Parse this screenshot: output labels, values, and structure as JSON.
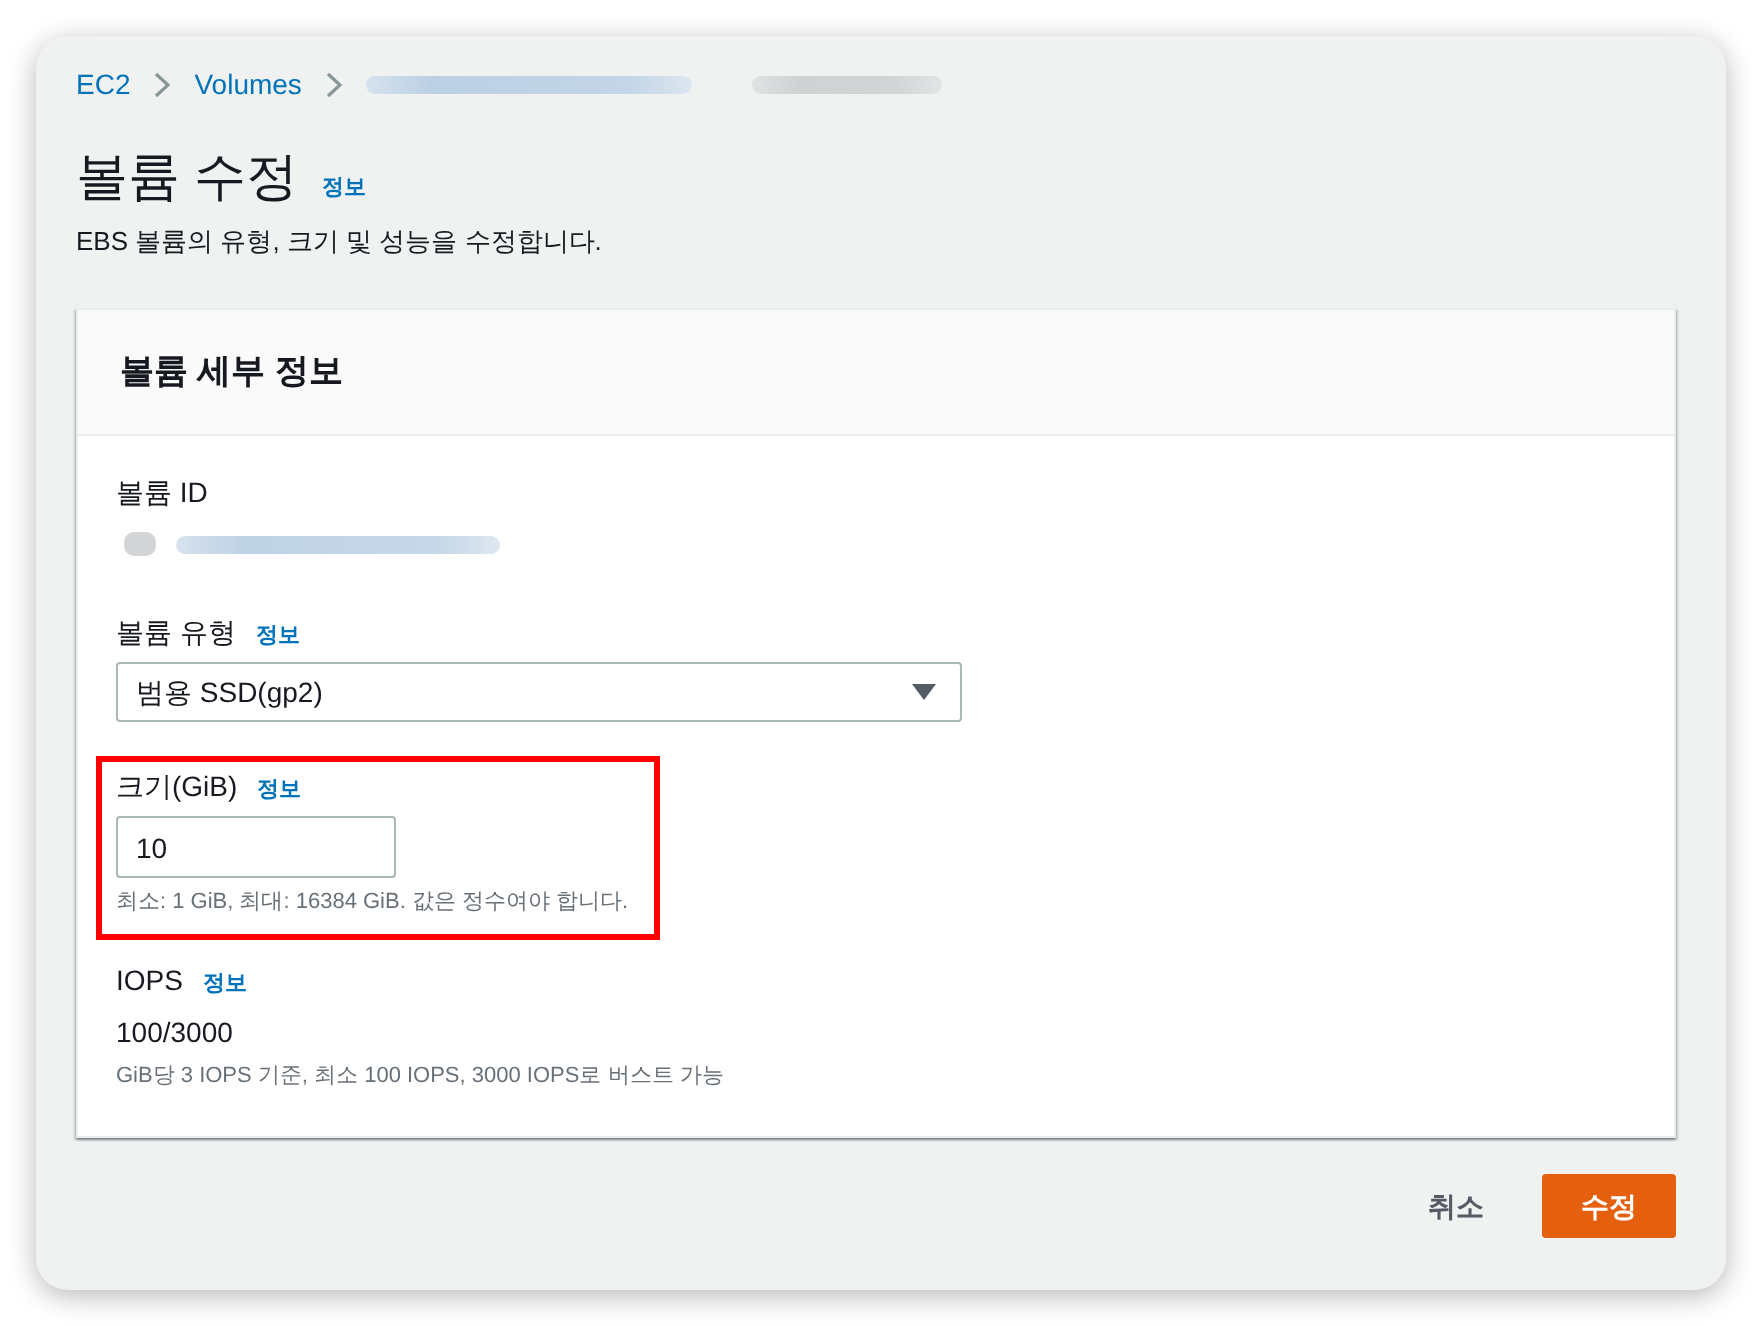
{
  "breadcrumbs": [
    {
      "kind": "link",
      "text": "EC2"
    },
    {
      "kind": "link",
      "text": "Volumes"
    },
    {
      "kind": "redacted_link"
    },
    {
      "kind": "redacted_text"
    }
  ],
  "page": {
    "title": "볼륨 수정",
    "info": "정보",
    "description": "EBS 볼륨의 유형, 크기 및 성능을 수정합니다."
  },
  "panel": {
    "title": "볼륨 세부 정보",
    "fields": [
      {
        "kind": "redacted_value",
        "label": "볼륨 ID",
        "highlighted": false
      },
      {
        "kind": "select",
        "label": "볼륨 유형",
        "info": "정보",
        "value": "범용 SSD(gp2)",
        "highlighted": false
      },
      {
        "kind": "input",
        "label": "크기(GiB)",
        "info": "정보",
        "value": "10",
        "hint": "최소: 1 GiB, 최대: 16384 GiB. 값은 정수여야 합니다.",
        "highlighted": true
      },
      {
        "kind": "text",
        "label": "IOPS",
        "info": "정보",
        "value": "100/3000",
        "hint": "GiB당 3 IOPS 기준, 최소 100 IOPS, 3000 IOPS로 버스트 가능",
        "highlighted": false
      }
    ]
  },
  "actions": [
    {
      "kind": "link",
      "label": "취소"
    },
    {
      "kind": "primary",
      "label": "수정"
    }
  ]
}
